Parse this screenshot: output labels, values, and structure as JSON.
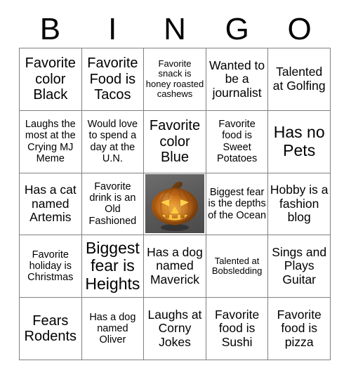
{
  "card": {
    "title": "BINGO",
    "header_letters": [
      "B",
      "I",
      "N",
      "G",
      "O"
    ],
    "grid_rows": 5,
    "grid_columns": 5,
    "border_color": "#808080",
    "text_color": "#000000",
    "background_color": "#ffffff",
    "cells": [
      [
        {
          "text": "Favorite color Black",
          "size": "lg",
          "type": "text"
        },
        {
          "text": "Favorite Food is Tacos",
          "size": "lg",
          "type": "text"
        },
        {
          "text": "Favorite snack is honey roasted cashews",
          "size": "xs",
          "type": "text"
        },
        {
          "text": "Wanted to be a journalist",
          "size": "md",
          "type": "text"
        },
        {
          "text": "Talented at Golfing",
          "size": "md",
          "type": "text"
        }
      ],
      [
        {
          "text": "Laughs the most at the Crying MJ Meme",
          "size": "sm",
          "type": "text"
        },
        {
          "text": "Would love to spend a day at the U.N.",
          "size": "sm",
          "type": "text"
        },
        {
          "text": "Favorite color Blue",
          "size": "lg",
          "type": "text"
        },
        {
          "text": "Favorite food is Sweet Potatoes",
          "size": "sm",
          "type": "text"
        },
        {
          "text": "Has no Pets",
          "size": "xl",
          "type": "text"
        }
      ],
      [
        {
          "text": "Has a cat named Artemis",
          "size": "md",
          "type": "text"
        },
        {
          "text": "Favorite drink is an Old Fashioned",
          "size": "sm",
          "type": "text"
        },
        {
          "text": "",
          "size": "md",
          "type": "image",
          "image": "jack-o-lantern-pumpkin"
        },
        {
          "text": "Biggest fear is the depths of the Ocean",
          "size": "sm",
          "type": "text"
        },
        {
          "text": "Hobby is a fashion blog",
          "size": "md",
          "type": "text"
        }
      ],
      [
        {
          "text": "Favorite holiday is Christmas",
          "size": "sm",
          "type": "text"
        },
        {
          "text": "Biggest fear is Heights",
          "size": "xl",
          "type": "text"
        },
        {
          "text": "Has a dog named Maverick",
          "size": "md",
          "type": "text"
        },
        {
          "text": "Talented at Bobsledding",
          "size": "xs",
          "type": "text"
        },
        {
          "text": "Sings and Plays Guitar",
          "size": "md",
          "type": "text"
        }
      ],
      [
        {
          "text": "Fears Rodents",
          "size": "lg",
          "type": "text"
        },
        {
          "text": "Has a dog named Oliver",
          "size": "sm",
          "type": "text"
        },
        {
          "text": "Laughs at Corny Jokes",
          "size": "md",
          "type": "text"
        },
        {
          "text": "Favorite food is Sushi",
          "size": "md",
          "type": "text"
        },
        {
          "text": "Favorite food is pizza",
          "size": "md",
          "type": "text"
        }
      ]
    ]
  }
}
